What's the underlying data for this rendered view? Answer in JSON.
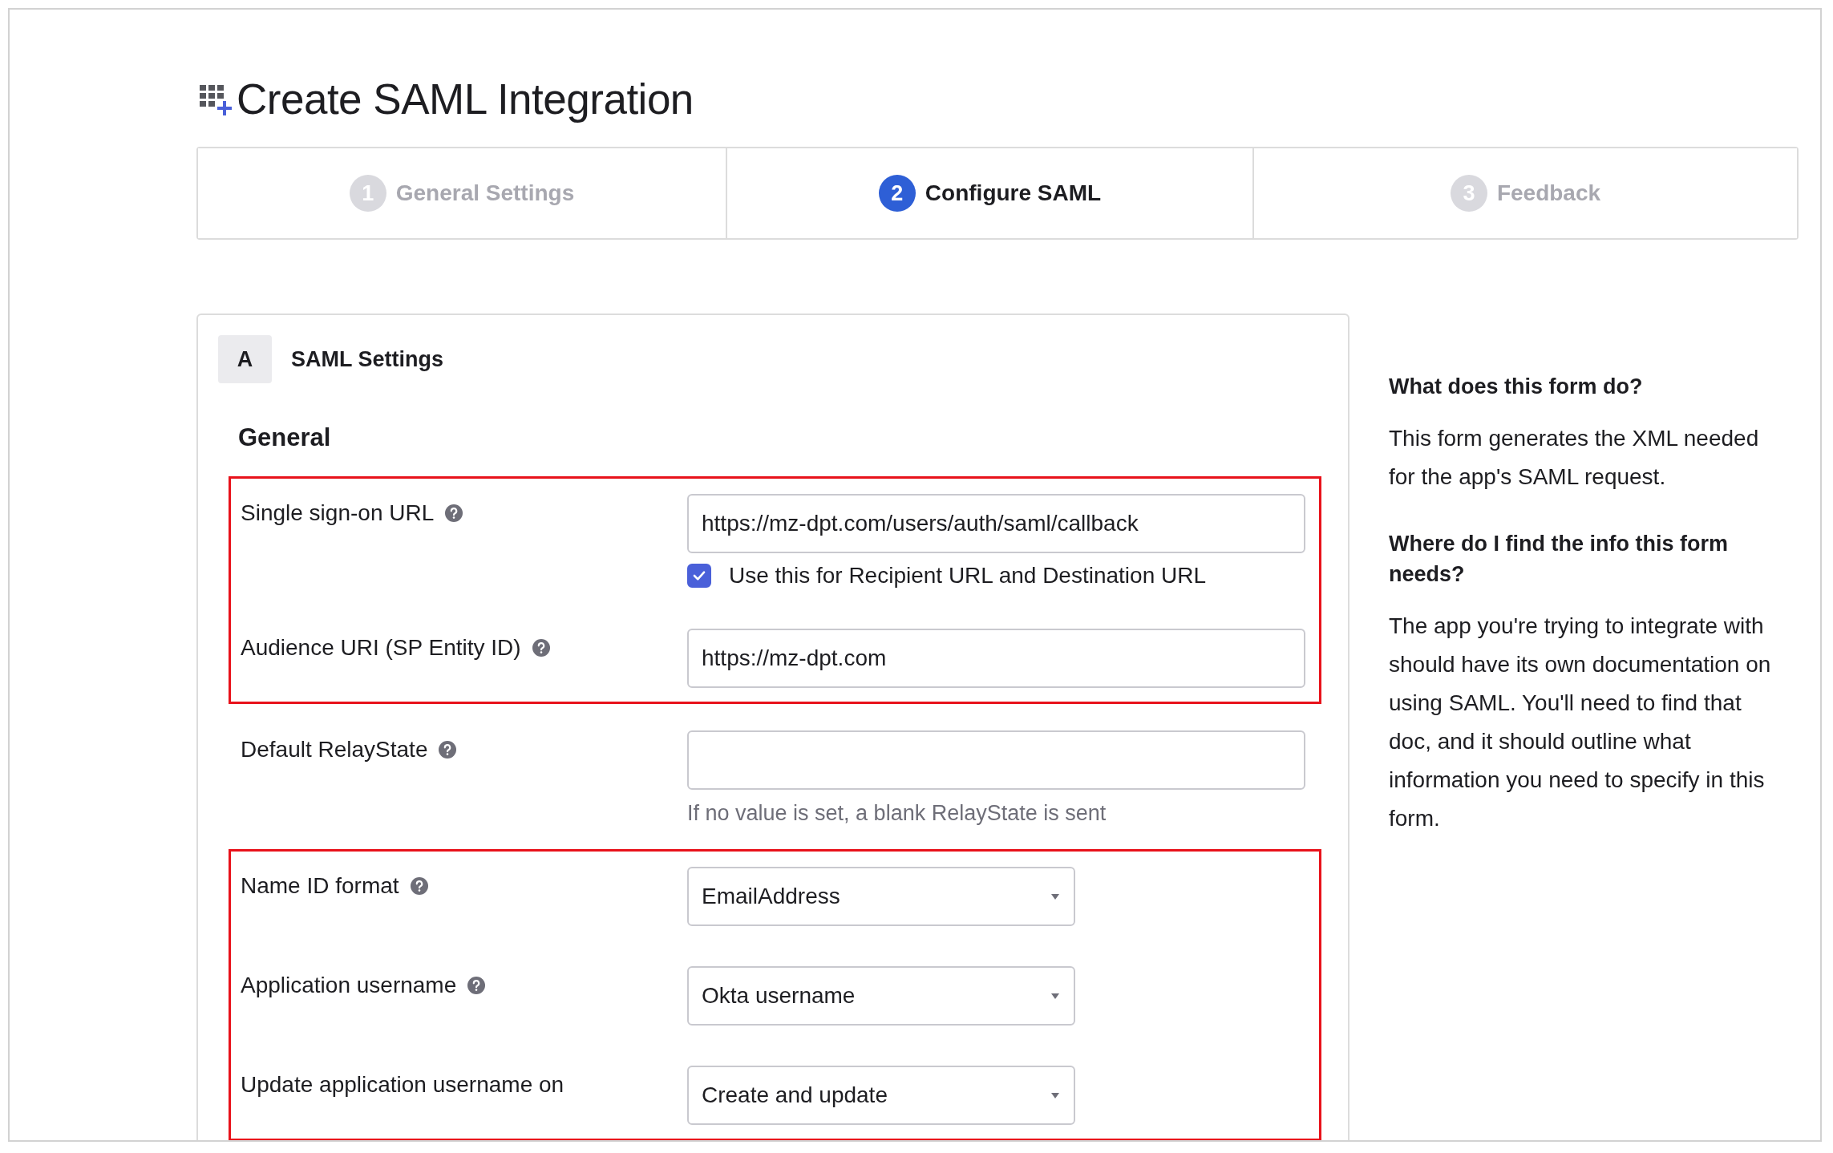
{
  "page": {
    "title": "Create SAML Integration"
  },
  "steps": [
    {
      "number": "1",
      "label": "General Settings",
      "selected": false
    },
    {
      "number": "2",
      "label": "Configure SAML",
      "selected": true
    },
    {
      "number": "3",
      "label": "Feedback",
      "selected": false
    }
  ],
  "section": {
    "letter": "A",
    "title": "SAML Settings",
    "subheading": "General",
    "groups": [
      {
        "highlighted": true,
        "fields": [
          {
            "kind": "text",
            "label": "Single sign-on URL",
            "help": true,
            "value": "https://mz-dpt.com/users/auth/saml/callback",
            "checkbox": {
              "label": "Use this for Recipient URL and Destination URL",
              "checked": true
            }
          },
          {
            "kind": "text",
            "label": "Audience URI (SP Entity ID)",
            "help": true,
            "value": "https://mz-dpt.com"
          }
        ]
      },
      {
        "highlighted": false,
        "fields": [
          {
            "kind": "text",
            "label": "Default RelayState",
            "help": true,
            "hint": "If no value is set, a blank RelayState is sent"
          }
        ]
      },
      {
        "highlighted": true,
        "fields": [
          {
            "kind": "select",
            "label": "Name ID format",
            "help": true,
            "value": "EmailAddress"
          },
          {
            "kind": "select",
            "label": "Application username",
            "help": true,
            "value": "Okta username"
          },
          {
            "kind": "select",
            "label": "Update application username on",
            "help": false,
            "value": "Create and update"
          }
        ]
      }
    ]
  },
  "sidebar": [
    {
      "heading": "What does this form do?",
      "body": "This form generates the XML needed for the app's SAML request."
    },
    {
      "heading": "Where do I find the info this form needs?",
      "body": "The app you're trying to integrate with should have its own documentation on using SAML. You'll need to find that doc, and it should outline what information you need to specify in this form."
    }
  ]
}
